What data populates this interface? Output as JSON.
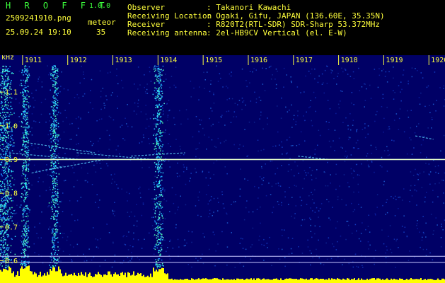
{
  "header": {
    "app_name": "H R O F F T",
    "version": "1.0.0",
    "filename": "2509241910.png",
    "datetime": "25.09.24 19:10",
    "meteor_label": "meteor",
    "meteor_count": "35"
  },
  "info": [
    {
      "key": "Observer",
      "value": ": Takanori Kawachi"
    },
    {
      "key": "Receiving Location",
      "value": ": Ogaki, Gifu, JAPAN (136.60E, 35.35N)"
    },
    {
      "key": "Receiver",
      "value": ": R820T2(RTL-SDR) SDR-Sharp 53.372MHz"
    },
    {
      "key": "Receiving antenna",
      "value": ": 2el-HB9CV Vertical (el. E-W)"
    }
  ],
  "colors": {
    "background": "#000066",
    "text_green": "#3cff3c",
    "text_yellow": "#ffff3c",
    "echo_line": "#e6ffcc",
    "signal_bars": "#ffff00"
  },
  "chart_data": {
    "type": "heatmap",
    "ylabel": "kHz",
    "x_ticks": [
      "1911",
      "1912",
      "1913",
      "1914",
      "1915",
      "1916",
      "1917",
      "1918",
      "1919",
      "1920"
    ],
    "y_ticks": [
      "1.1",
      "1.0",
      "0.9",
      "0.8",
      "0.7",
      "0.6"
    ],
    "ylim": [
      0.58,
      1.18
    ],
    "xlim": [
      1910.5,
      1920.2
    ],
    "carrier_khz": 0.9,
    "vertical_bursts_min": [
      1910.6,
      1911.05,
      1911.7,
      1914.0
    ]
  }
}
